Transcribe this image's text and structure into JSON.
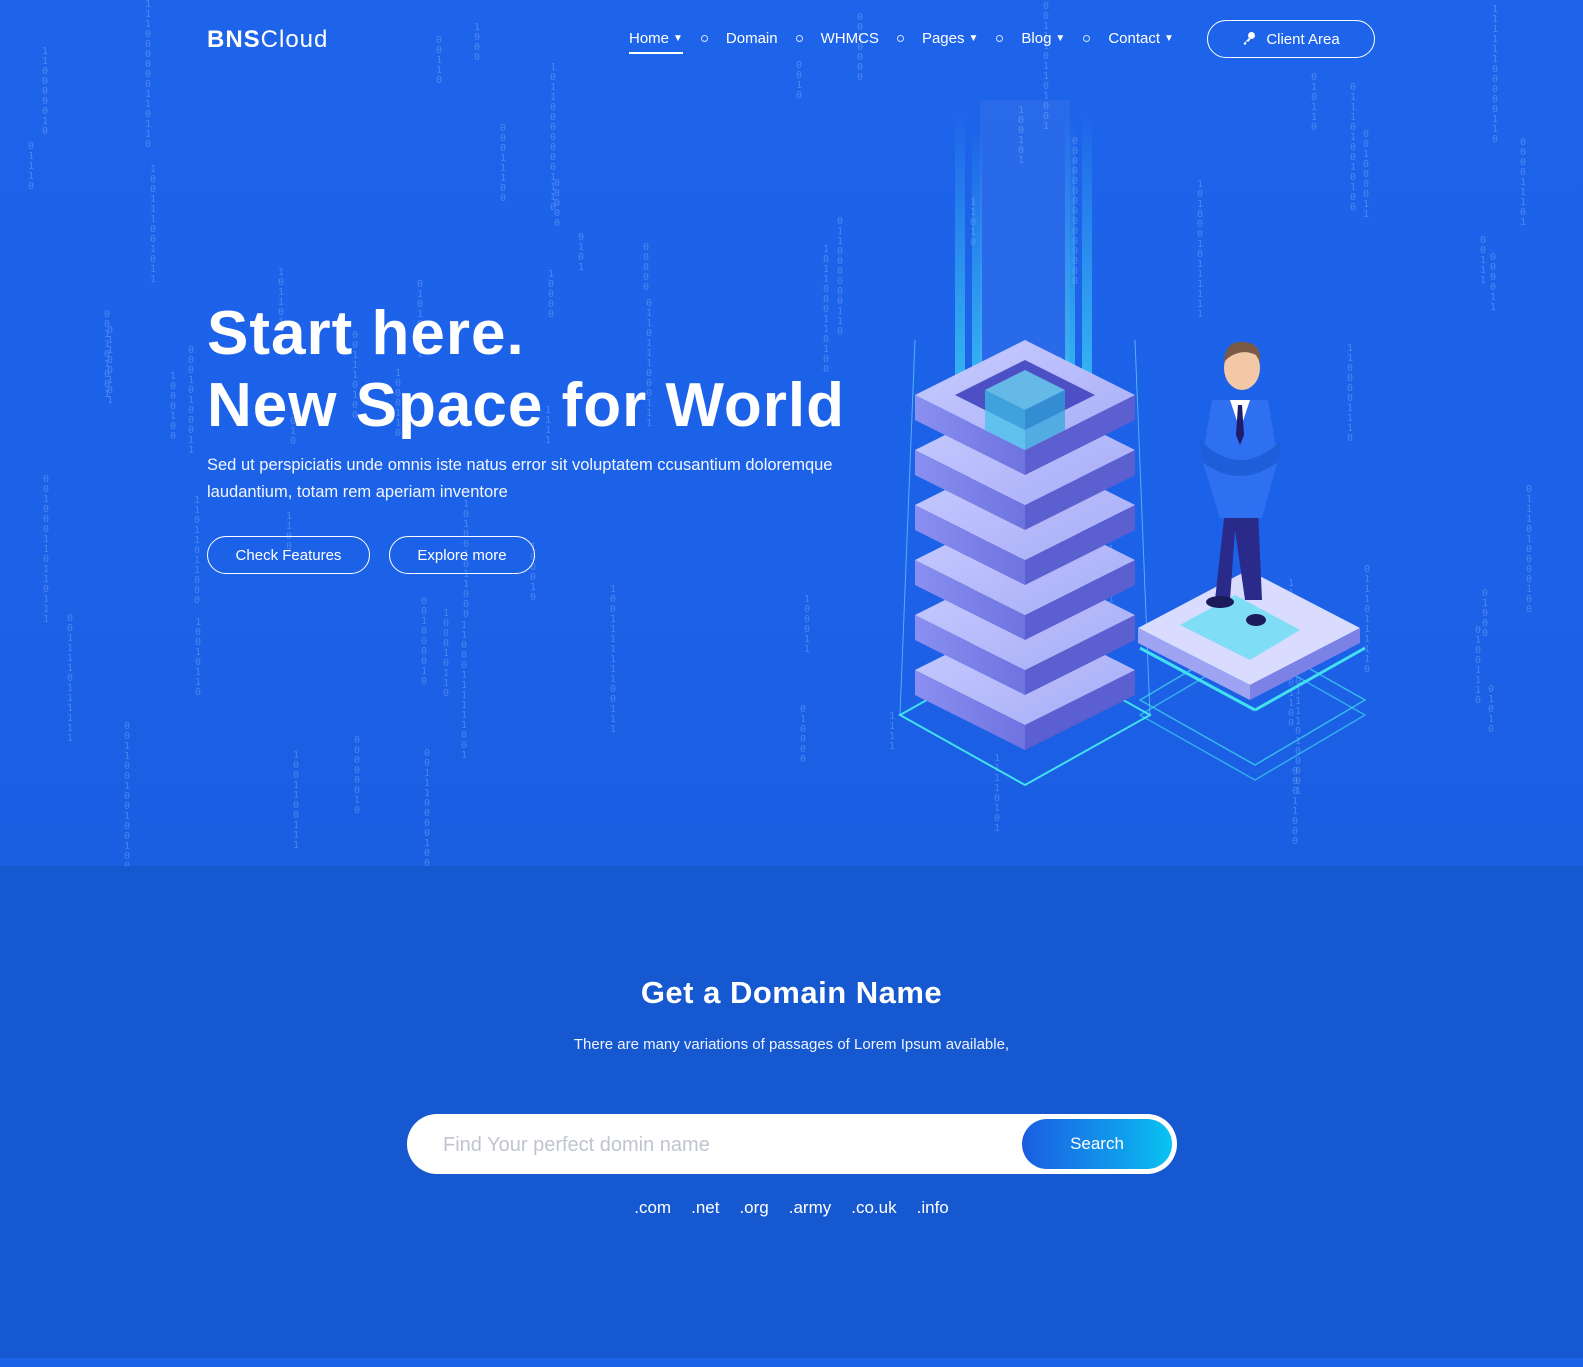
{
  "header": {
    "logo_bold": "BNS",
    "logo_light": "Cloud",
    "nav": [
      {
        "label": "Home",
        "dropdown": true,
        "active": true
      },
      {
        "label": "Domain",
        "dropdown": false
      },
      {
        "label": "WHMCS",
        "dropdown": false
      },
      {
        "label": "Pages",
        "dropdown": true
      },
      {
        "label": "Blog",
        "dropdown": true
      },
      {
        "label": "Contact",
        "dropdown": true
      }
    ],
    "client_area": "Client Area"
  },
  "hero": {
    "title_line1": "Start here.",
    "title_line2": "New Space for World",
    "subtitle": "Sed ut perspiciatis unde omnis iste natus error sit voluptatem ccusantium doloremque laudantium, totam rem aperiam inventore",
    "btn_features": "Check Features",
    "btn_explore": "Explore more"
  },
  "domain": {
    "title": "Get a Domain Name",
    "subtitle": "There are many variations of passages of Lorem Ipsum available,",
    "placeholder": "Find Your perfect domin name",
    "search_label": "Search",
    "tlds": [
      ".com",
      ".net",
      ".org",
      ".army",
      ".co.uk",
      ".info"
    ]
  },
  "colors": {
    "hero_bg": "#1e64ea",
    "section_bg": "#1558cf",
    "accent_cyan": "#09c4f2"
  }
}
